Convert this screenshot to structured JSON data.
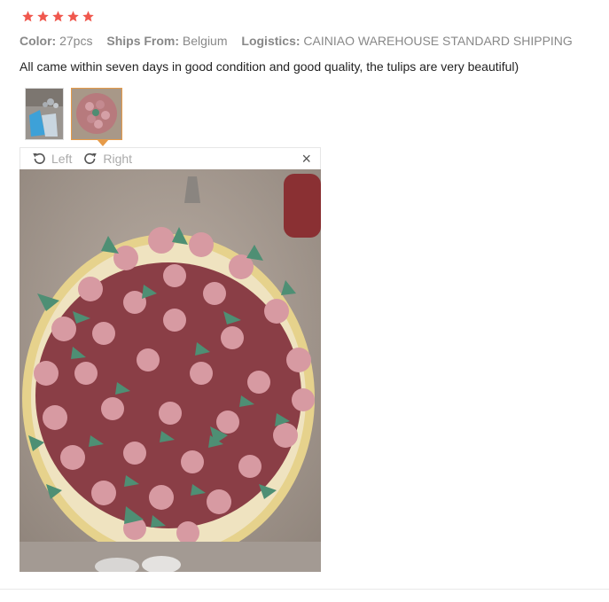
{
  "rating": {
    "stars": 5,
    "star_color": "#f0584e"
  },
  "meta": {
    "color_key": "Color:",
    "color_val": "27pcs",
    "ships_key": "Ships From:",
    "ships_val": "Belgium",
    "logistics_key": "Logistics:",
    "logistics_val": "CAINIAO WAREHOUSE STANDARD SHIPPING"
  },
  "review_text": "All came within seven days in good condition and good quality, the tulips are very beautiful)",
  "thumbnails": [
    {
      "name": "nozzles-photo",
      "active": false
    },
    {
      "name": "tulip-cake-photo",
      "active": true
    }
  ],
  "viewer": {
    "rotate_left_label": "Left",
    "rotate_right_label": "Right",
    "close_glyph": "×"
  },
  "accent_color": "#e69b49"
}
